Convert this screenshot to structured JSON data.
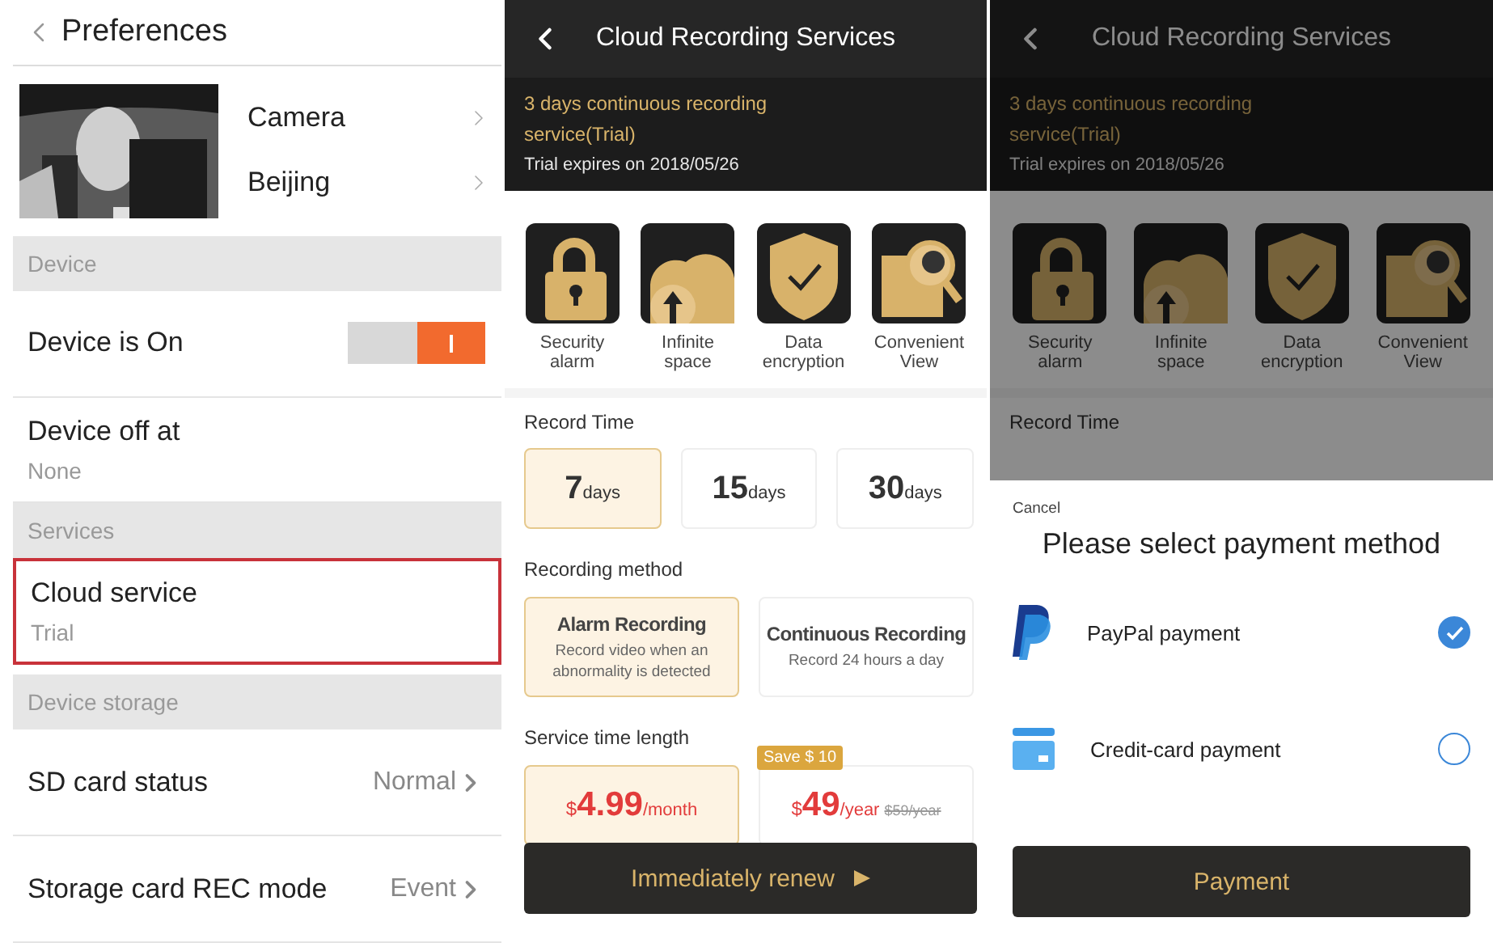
{
  "preferences": {
    "title": "Preferences",
    "camera": {
      "name": "Camera",
      "location": "Beijing"
    },
    "sections": [
      {
        "header": "Device",
        "rows": [
          {
            "kind": "toggle",
            "title": "Device is On",
            "on": true,
            "highlighted": false
          },
          {
            "kind": "subtitle",
            "title": "Device off at",
            "subtitle": "None",
            "highlighted": false
          }
        ]
      },
      {
        "header": "Services",
        "rows": [
          {
            "kind": "subtitle",
            "title": "Cloud service",
            "subtitle": "Trial",
            "highlighted": true
          }
        ]
      },
      {
        "header": "Device storage",
        "rows": [
          {
            "kind": "value",
            "title": "SD card status",
            "value": "Normal",
            "highlighted": false
          },
          {
            "kind": "value",
            "title": "Storage card REC mode",
            "value": "Event",
            "highlighted": false
          }
        ]
      }
    ]
  },
  "cloud": {
    "title": "Cloud Recording Services",
    "banner_title": "3 days continuous recording service(Trial)",
    "banner_subtitle": "Trial expires on 2018/05/26",
    "features": [
      {
        "kind": "lock",
        "label": "Security alarm"
      },
      {
        "kind": "cloud",
        "label": "Infinite space"
      },
      {
        "kind": "shield",
        "label": "Data encryption"
      },
      {
        "kind": "search",
        "label": "Convenient View"
      }
    ],
    "record_time_label": "Record Time",
    "record_times": [
      {
        "value": "7",
        "unit": "days",
        "selected": true
      },
      {
        "value": "15",
        "unit": "days",
        "selected": false
      },
      {
        "value": "30",
        "unit": "days",
        "selected": false
      }
    ],
    "method_label": "Recording method",
    "methods": [
      {
        "title": "Alarm Recording",
        "description": "Record video when an abnormality is detected",
        "selected": true
      },
      {
        "title": "Continuous Recording",
        "description": "Record 24 hours a day",
        "selected": false
      }
    ],
    "length_label": "Service time length",
    "plans": [
      {
        "currency": "$",
        "amount": "4.99",
        "unit": "/month",
        "selected": true
      },
      {
        "currency": "$",
        "amount": "49",
        "unit": "/year",
        "old_price": "$59/year",
        "badge": "Save $ 10",
        "selected": false
      }
    ],
    "button": "Immediately renew"
  },
  "payment": {
    "title": "Cloud Recording Services",
    "banner_title": "3 days continuous recording service(Trial)",
    "banner_subtitle": "Trial expires on 2018/05/26",
    "features": [
      {
        "kind": "lock",
        "label": "Security alarm"
      },
      {
        "kind": "cloud",
        "label": "Infinite space"
      },
      {
        "kind": "shield",
        "label": "Data encryption"
      },
      {
        "kind": "search",
        "label": "Convenient View"
      }
    ],
    "record_time_label": "Record Time",
    "sheet": {
      "cancel": "Cancel",
      "title": "Please select payment method",
      "methods": [
        {
          "kind": "paypal",
          "label": "PayPal payment",
          "selected": true
        },
        {
          "kind": "card",
          "label": "Credit-card payment",
          "selected": false
        }
      ],
      "button": "Payment"
    }
  }
}
